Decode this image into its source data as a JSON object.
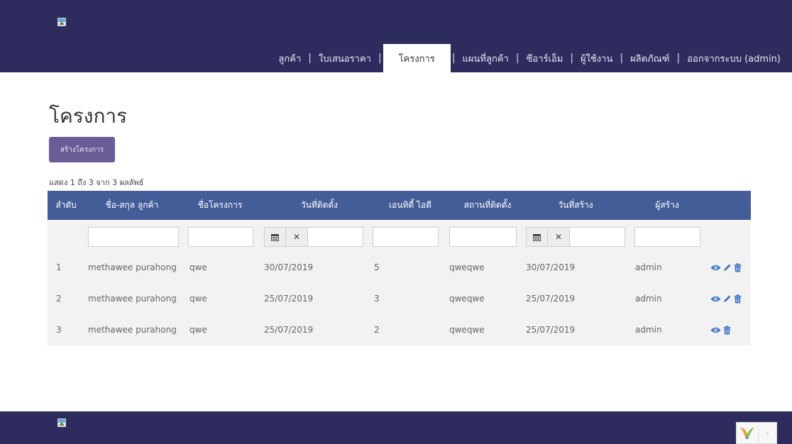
{
  "nav": {
    "items": [
      {
        "label": "ลูกค้า",
        "active": false
      },
      {
        "label": "ใบเสนอราคา",
        "active": false
      },
      {
        "label": "โครงการ",
        "active": true
      },
      {
        "label": "แผนที่ลูกค้า",
        "active": false
      },
      {
        "label": "ซีอาร์เอ็ม",
        "active": false
      },
      {
        "label": "ผู้ใช้งาน",
        "active": false
      },
      {
        "label": "ผลิตภัณฑ์",
        "active": false
      },
      {
        "label": "ออกจากระบบ (admin)",
        "active": false
      }
    ]
  },
  "page": {
    "title": "โครงการ",
    "create_button": "สร้างโครงการ",
    "summary": "แสดง 1 ถึง 3 จาก 3 ผลลัพธ์"
  },
  "grid": {
    "columns": [
      "ลำดับ",
      "ชื่อ-สกุล ลูกค้า",
      "ชื่อโครงการ",
      "วันที่ติดตั้ง",
      "เอนทิตี้ ไอดี",
      "สถานที่ติดตั้ง",
      "วันที่สร้าง",
      "ผู้สร้าง"
    ],
    "rows": [
      {
        "no": "1",
        "customer": "methawee purahong",
        "project": "qwe",
        "install_date": "30/07/2019",
        "entity_id": "5",
        "location": "qweqwe",
        "created": "30/07/2019",
        "creator": "admin"
      },
      {
        "no": "2",
        "customer": "methawee purahong",
        "project": "qwe",
        "install_date": "25/07/2019",
        "entity_id": "3",
        "location": "qweqwe",
        "created": "25/07/2019",
        "creator": "admin"
      },
      {
        "no": "3",
        "customer": "methawee purahong",
        "project": "qwe",
        "install_date": "25/07/2019",
        "entity_id": "2",
        "location": "qweqwe",
        "created": "25/07/2019",
        "creator": "admin"
      }
    ]
  },
  "icons": {
    "calendar": "calendar-icon",
    "clear": "clear-icon",
    "view": "eye-icon",
    "edit": "pencil-icon",
    "delete": "trash-icon"
  },
  "colors": {
    "header_bg": "#2e2c5f",
    "grid_header": "#445d98",
    "button": "#6b5c97",
    "action_icon": "#3f74c4"
  }
}
